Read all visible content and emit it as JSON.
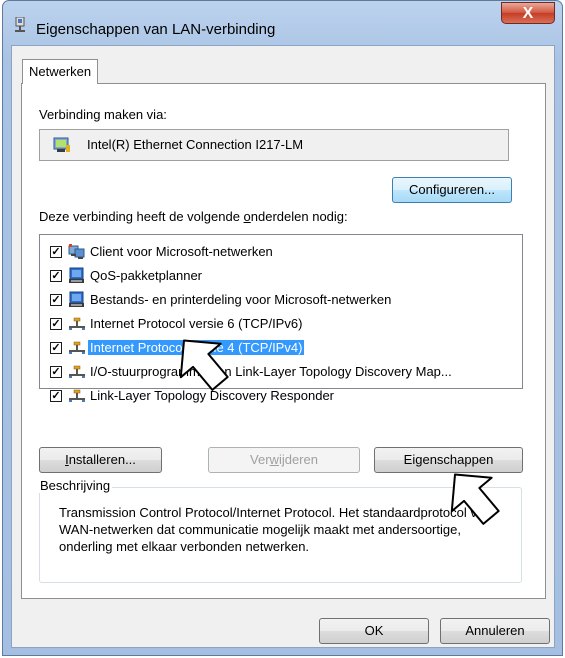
{
  "window": {
    "title": "Eigenschappen van LAN-verbinding",
    "close_label": "X"
  },
  "tabs": [
    {
      "label": "Netwerken",
      "selected": true
    }
  ],
  "connect_via": {
    "label": "Verbinding maken via:",
    "adapter": "Intel(R) Ethernet Connection I217-LM",
    "configure_button": "Configureren..."
  },
  "components": {
    "label_pre": "Deze verbinding heeft de volgende ",
    "label_access": "o",
    "label_post": "nderdelen nodig:",
    "items": [
      {
        "label": "Client voor Microsoft-netwerken",
        "checked": true,
        "icon": "network-client-icon"
      },
      {
        "label": "QoS-pakketplanner",
        "checked": true,
        "icon": "network-service-icon"
      },
      {
        "label": "Bestands- en printerdeling voor Microsoft-netwerken",
        "checked": true,
        "icon": "network-service-icon"
      },
      {
        "label": "Internet Protocol versie 6 (TCP/IPv6)",
        "checked": true,
        "icon": "protocol-icon"
      },
      {
        "label": "Internet Protocol versie 4 (TCP/IPv4)",
        "checked": true,
        "icon": "protocol-icon",
        "selected": true
      },
      {
        "label": "I/O-stuurprogramma van Link-Layer Topology Discovery Map...",
        "checked": true,
        "icon": "protocol-icon"
      },
      {
        "label": "Link-Layer Topology Discovery Responder",
        "checked": true,
        "icon": "protocol-icon"
      }
    ]
  },
  "buttons": {
    "install_access": "I",
    "install_rest": "nstalleren...",
    "remove_pre": "Ver",
    "remove_access": "w",
    "remove_post": "ijderen",
    "properties_pre": "Eigenschappen",
    "ok": "OK",
    "cancel": "Annuleren"
  },
  "description": {
    "legend": "Beschrijving",
    "text": "Transmission Control Protocol/Internet Protocol. Het standaardprotocol voor WAN-netwerken dat communicatie mogelijk maakt met andersoortige, onderling met elkaar verbonden netwerken."
  },
  "colors": {
    "selection": "#3399ff",
    "window_frame": "#a9c3e4",
    "close_button": "#c43d24"
  }
}
